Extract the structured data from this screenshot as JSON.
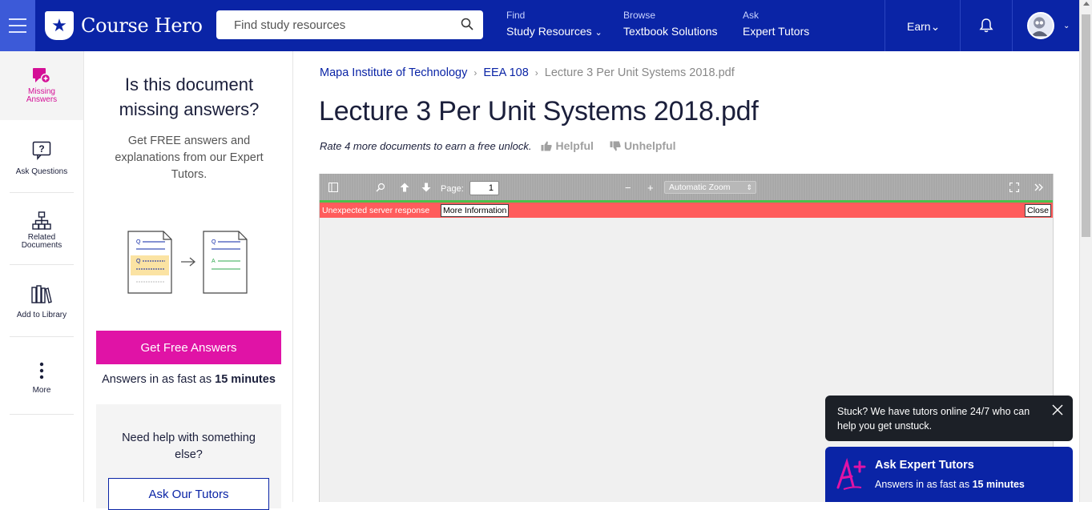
{
  "header": {
    "brand": "Course Hero",
    "search_placeholder": "Find study resources",
    "nav": [
      {
        "small": "Find",
        "big": "Study Resources",
        "caret": "⌄"
      },
      {
        "small": "Browse",
        "big": "Textbook Solutions",
        "caret": ""
      },
      {
        "small": "Ask",
        "big": "Expert Tutors",
        "caret": ""
      }
    ],
    "earn": "Earn⌄",
    "avatar_caret": "⌄"
  },
  "rail": {
    "items": [
      {
        "label_line1": "Missing",
        "label_line2": "Answers",
        "icon": "missing-answers-icon"
      },
      {
        "label_line1": "Ask Questions",
        "label_line2": "",
        "icon": "ask-question-icon"
      },
      {
        "label_line1": "Related",
        "label_line2": "Documents",
        "icon": "related-documents-icon"
      },
      {
        "label_line1": "Add to Library",
        "label_line2": "",
        "icon": "library-icon"
      },
      {
        "label_line1": "More",
        "label_line2": "",
        "icon": "more-icon"
      }
    ]
  },
  "promo": {
    "title": "Is this document missing answers?",
    "subtitle": "Get FREE answers and explanations from our Expert Tutors.",
    "cta": "Get Free Answers",
    "fast_prefix": "Answers in as fast as ",
    "fast_bold": "15 minutes",
    "help_text": "Need help with something else?",
    "tutors_button": "Ask Our Tutors",
    "illus_q": "Q",
    "illus_a": "A"
  },
  "breadcrumb": {
    "school": "Mapa Institute of Technology",
    "course": "EEA 108",
    "current": "Lecture 3 Per Unit Systems 2018.pdf",
    "sep": "›"
  },
  "document": {
    "title": "Lecture 3 Per Unit Systems 2018.pdf",
    "rate_text": "Rate 4 more documents to earn a free unlock.",
    "helpful": "Helpful",
    "unhelpful": "Unhelpful"
  },
  "viewer": {
    "page_label": "Page:",
    "page_value": "1",
    "zoom": "Automatic Zoom",
    "minus": "−",
    "plus": "+",
    "error_message": "Unexpected server response",
    "more_info": "More Information",
    "close": "Close"
  },
  "toasts": {
    "stuck": "Stuck? We have tutors online 24/7 who can help you get unstuck.",
    "ask_title": "Ask Expert Tutors",
    "ask_sub_prefix": "Answers in as fast as ",
    "ask_sub_bold": "15 minutes"
  },
  "colors": {
    "brand_blue": "#0a24a6",
    "accent_pink": "#e013a6",
    "error_red": "#ff5c5c"
  }
}
